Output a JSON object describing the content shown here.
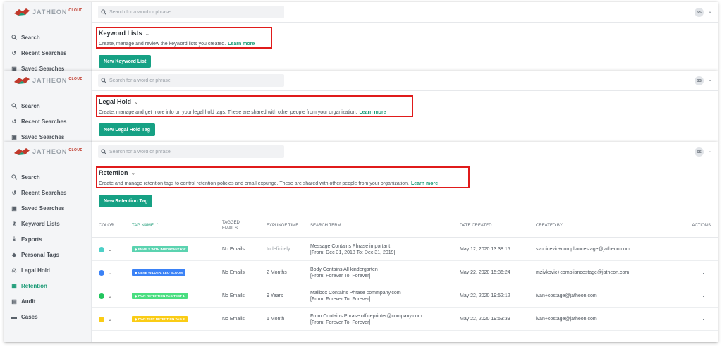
{
  "app": {
    "logo_text": "JATHEON",
    "logo_cloud": "CLOUD",
    "avatar": "SS"
  },
  "search": {
    "placeholder": "Search for a word or phrase"
  },
  "nav": {
    "search": "Search",
    "recent_searches": "Recent Searches",
    "saved_searches": "Saved Searches",
    "keyword_lists": "Keyword Lists",
    "exports": "Exports",
    "personal_tags": "Personal Tags",
    "legal_hold": "Legal Hold",
    "retention": "Retention",
    "audit": "Audit",
    "cases": "Cases"
  },
  "keyword_lists": {
    "title": "Keyword Lists",
    "description": "Create, manage and review the keyword lists you created.",
    "learn_more": "Learn more",
    "button": "New Keyword List"
  },
  "legal_hold": {
    "title": "Legal Hold",
    "description": "Create, manage and get more info on your legal hold tags. These are shared with other people from your organization.",
    "learn_more": "Learn more",
    "button": "New Legal Hold Tag"
  },
  "retention": {
    "title": "Retention",
    "description": "Create and manage retention tags to control retention policies and email expunge. These are shared with other people from your organization.",
    "learn_more": "Learn more",
    "button": "New Retention Tag",
    "columns": {
      "color": "COLOR",
      "tag_name": "TAG NAME",
      "tagged_emails_1": "TAGGED",
      "tagged_emails_2": "EMAILS",
      "expunge_time": "EXPUNGE TIME",
      "search_term": "SEARCH TERM",
      "date_created": "DATE CREATED",
      "created_by": "CREATED BY",
      "actions": "ACTIONS"
    },
    "rows": [
      {
        "color": "#4dd0c7",
        "tag": "EMAILS WITH IMPORTANT KW",
        "tag_color": "#5bd3b0",
        "tagged": "No Emails",
        "expunge": "Indefinitely",
        "expunge_muted": true,
        "term_1": "Message Contains Phrase important",
        "term_2": "[From: Dec 31, 2018 To: Dec 31, 2019]",
        "date": "May 12, 2020 13:38:15",
        "created_by": "svucicevic+compliancestage@jatheon.com",
        "actions": "···"
      },
      {
        "color": "#3b82f6",
        "tag": "GENE WILDER: LEO BLOOM",
        "tag_color": "#3b82f6",
        "tagged": "No Emails",
        "expunge": "2 Months",
        "expunge_muted": false,
        "term_1": "Body Contains All kindergarten",
        "term_2": "[From: Forever To: Forever]",
        "date": "May 22, 2020 15:36:24",
        "created_by": "mzivkovic+compliancestage@jatheon.com",
        "actions": "···"
      },
      {
        "color": "#22c55e",
        "tag": "IVAN RETENTION TAG TEST 1",
        "tag_color": "#4ade80",
        "tagged": "No Emails",
        "expunge": "9 Years",
        "expunge_muted": false,
        "term_1": "Mailbox Contains Phrase commpany.com",
        "term_2": "[From: Forever To: Forever]",
        "date": "May 22, 2020 19:52:12",
        "created_by": "ivan+costage@jatheon.com",
        "actions": "···"
      },
      {
        "color": "#facc15",
        "tag": "IVAN TEST RETENTION TAG 2",
        "tag_color": "#facc15",
        "tagged": "No Emails",
        "expunge": "1 Month",
        "expunge_muted": false,
        "term_1": "From Contains Phrase officeprinter@company.com",
        "term_2": "[From: Forever To: Forever]",
        "date": "May 22, 2020 19:53:39",
        "created_by": "ivan+costage@jatheon.com",
        "actions": "···"
      }
    ]
  },
  "colors": {
    "accent": "#16a184",
    "highlight": "#e01b1b"
  }
}
